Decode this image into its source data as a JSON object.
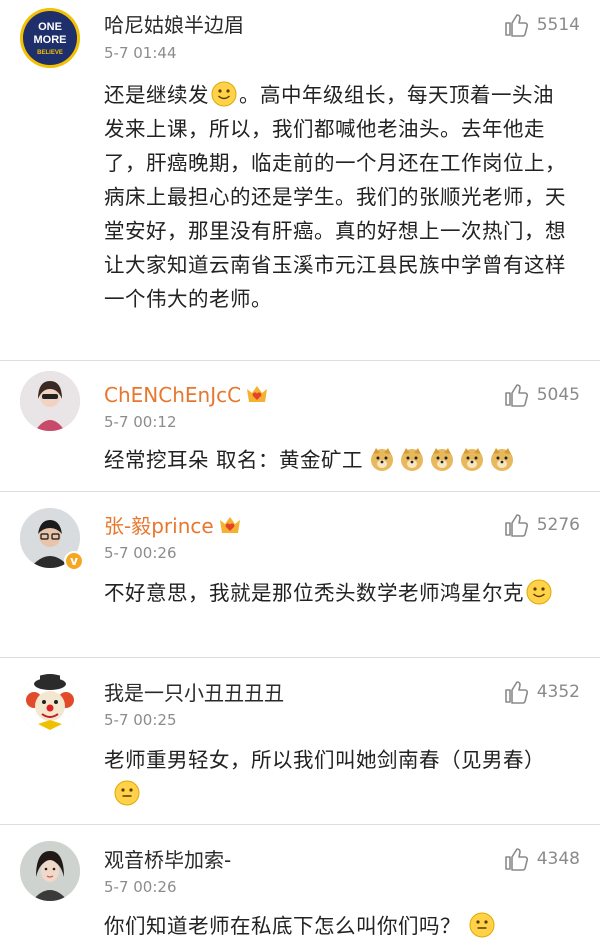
{
  "comments": [
    {
      "username": "哈尼姑娘半边眉",
      "timestamp": "5-7 01:44",
      "likes": "5514",
      "avatar_text": {
        "line1": "ONE",
        "line2": "MORE",
        "line3": "BELIEVE"
      },
      "text_a": "还是继续发",
      "text_b": "。高中年级组长，每天顶着一头油发来上课，所以，我们都喊他老油头。去年他走了，肝癌晚期，临走前的一个月还在工作岗位上，病床上最担心的还是学生。我们的张顺光老师，天堂安好，那里没有肝癌。真的好想上一次热门，想让大家知道云南省玉溪市元江县民族中学曾有这样一个伟大的老师。"
    },
    {
      "username": "ChENChEnJcC",
      "timestamp": "5-7 00:12",
      "likes": "5045",
      "text": "经常挖耳朵 取名：黄金矿工"
    },
    {
      "username": "张-毅prince",
      "timestamp": "5-7 00:26",
      "likes": "5276",
      "verified_mark": "v",
      "text": "不好意思，我就是那位秃头数学老师鸿星尔克"
    },
    {
      "username": "我是一只小丑丑丑丑",
      "timestamp": "5-7 00:25",
      "likes": "4352",
      "text": "老师重男轻女，所以我们叫她剑南春（见男春）"
    },
    {
      "username": "观音桥毕加索-",
      "timestamp": "5-7 00:26",
      "likes": "4348",
      "text": "你们知道老师在私底下怎么叫你们吗？"
    }
  ],
  "colors": {
    "vip_name": "#e8772e",
    "plain_name": "#2a2a2a",
    "meta": "#8c8c8c",
    "divider": "#dedede",
    "verified_badge": "#f5a623"
  },
  "icons": [
    "thumbs-up-icon",
    "smile-emoji-icon",
    "doge-emoji-icon",
    "crown-heart-badge-icon",
    "verified-badge-icon"
  ]
}
